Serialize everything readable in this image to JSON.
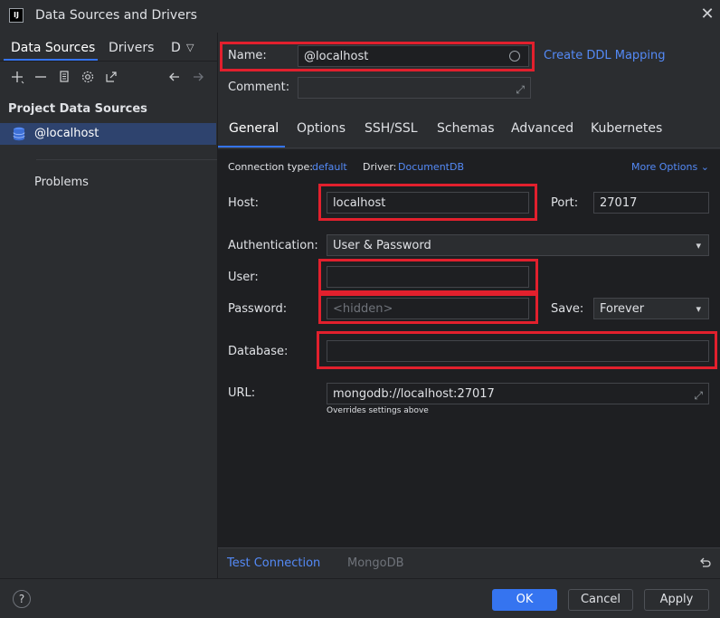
{
  "window": {
    "title": "Data Sources and Drivers",
    "logo_text": "IJ"
  },
  "sidebar": {
    "tabs": [
      {
        "label": "Data Sources"
      },
      {
        "label": "Drivers"
      },
      {
        "label": "D"
      }
    ],
    "section_title": "Project Data Sources",
    "items": [
      {
        "label": "@localhost"
      }
    ],
    "problems_label": "Problems"
  },
  "header": {
    "name_label": "Name:",
    "name_value": "@localhost",
    "comment_label": "Comment:",
    "comment_value": "",
    "ddl_link": "Create DDL Mapping"
  },
  "tabs": [
    {
      "label": "General"
    },
    {
      "label": "Options"
    },
    {
      "label": "SSH/SSL"
    },
    {
      "label": "Schemas"
    },
    {
      "label": "Advanced"
    },
    {
      "label": "Kubernetes"
    }
  ],
  "general": {
    "connection_type_label": "Connection type:",
    "connection_type_value": "default",
    "driver_label": "Driver:",
    "driver_value": "DocumentDB",
    "more_options": "More Options",
    "host_label": "Host:",
    "host_value": "localhost",
    "port_label": "Port:",
    "port_value": "27017",
    "auth_label": "Authentication:",
    "auth_value": "User & Password",
    "user_label": "User:",
    "user_value": "",
    "password_label": "Password:",
    "password_placeholder": "<hidden>",
    "save_label": "Save:",
    "save_value": "Forever",
    "database_label": "Database:",
    "database_value": "",
    "url_label": "URL:",
    "url_value": "mongodb://localhost:27017",
    "url_hint": "Overrides settings above"
  },
  "bottom_bar": {
    "test_connection": "Test Connection",
    "driver_name": "MongoDB"
  },
  "footer": {
    "help": "?",
    "ok": "OK",
    "cancel": "Cancel",
    "apply": "Apply"
  },
  "colors": {
    "accent": "#3574f0",
    "link": "#548af7",
    "highlight_box": "#e2202d",
    "selected_row": "#2e436e"
  }
}
